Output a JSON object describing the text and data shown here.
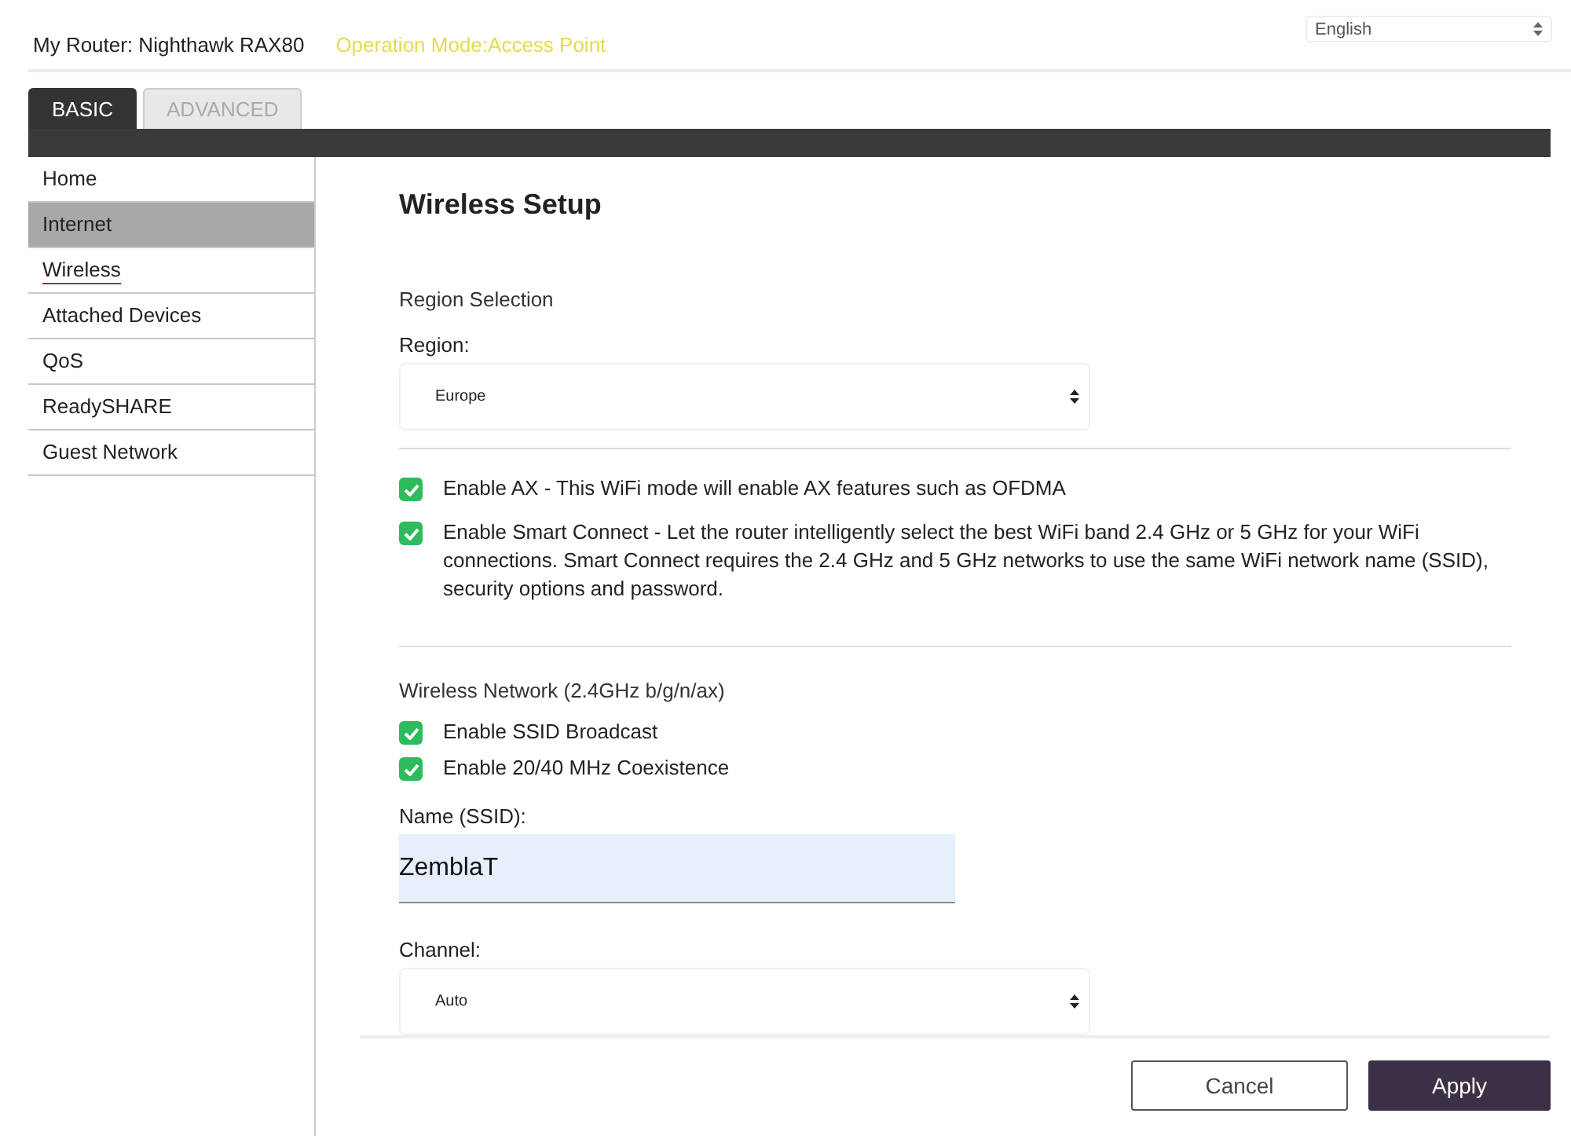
{
  "header": {
    "router_label": "My Router:",
    "router_name": "Nighthawk RAX80",
    "operation_mode": "Operation Mode:Access Point",
    "language": "English"
  },
  "tabs": [
    {
      "label": "BASIC",
      "selected": true
    },
    {
      "label": "ADVANCED",
      "selected": false
    }
  ],
  "sidebar": {
    "items": [
      {
        "label": "Home",
        "selected": false,
        "highlighted": false
      },
      {
        "label": "Internet",
        "selected": false,
        "highlighted": true
      },
      {
        "label": "Wireless",
        "selected": true,
        "highlighted": false
      },
      {
        "label": "Attached Devices",
        "selected": false,
        "highlighted": false
      },
      {
        "label": "QoS",
        "selected": false,
        "highlighted": false
      },
      {
        "label": "ReadySHARE",
        "selected": false,
        "highlighted": false
      },
      {
        "label": "Guest Network",
        "selected": false,
        "highlighted": false
      }
    ]
  },
  "main": {
    "title": "Wireless Setup",
    "region_section": "Region Selection",
    "region_label": "Region:",
    "region_value": "Europe",
    "options": [
      {
        "label": "Enable AX - This WiFi mode will enable AX features such as OFDMA",
        "checked": true
      },
      {
        "label": "Enable Smart Connect - Let the router intelligently select the best WiFi band 2.4 GHz or 5 GHz for your WiFi connections. Smart Connect requires the 2.4 GHz and 5 GHz networks to use the same WiFi network name (SSID), security options and password.",
        "checked": true
      }
    ],
    "network_section": "Wireless Network (2.4GHz b/g/n/ax)",
    "network_options": [
      {
        "label": "Enable SSID Broadcast",
        "checked": true
      },
      {
        "label": "Enable 20/40 MHz Coexistence",
        "checked": true
      }
    ],
    "ssid_label": "Name (SSID):",
    "ssid_value": "ZemblaT",
    "channel_label": "Channel:",
    "channel_value": "Auto"
  },
  "buttons": {
    "cancel": "Cancel",
    "apply": "Apply"
  }
}
